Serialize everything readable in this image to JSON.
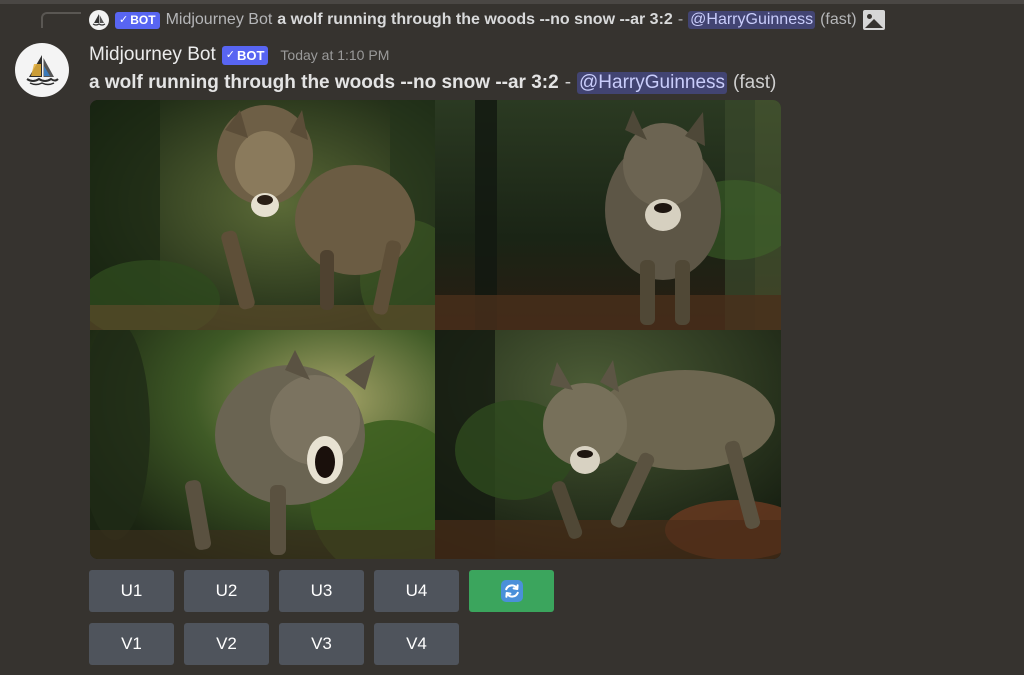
{
  "reply": {
    "bot_label": "BOT",
    "author": "Midjourney Bot",
    "prompt": "a wolf running through the woods --no snow --ar 3:2",
    "separator": "-",
    "mention": "@HarryGuinness",
    "speed": "(fast)"
  },
  "message": {
    "author": "Midjourney Bot",
    "bot_label": "BOT",
    "timestamp": "Today at 1:10 PM",
    "prompt": "a wolf running through the woods --no snow --ar 3:2",
    "separator": "-",
    "mention": "@HarryGuinness",
    "speed": "(fast)"
  },
  "image_grid": {
    "tiles": [
      "wolf-image-1",
      "wolf-image-2",
      "wolf-image-3",
      "wolf-image-4"
    ]
  },
  "buttons": {
    "upscale": [
      "U1",
      "U2",
      "U3",
      "U4"
    ],
    "variation": [
      "V1",
      "V2",
      "V3",
      "V4"
    ],
    "reroll_icon": "refresh-icon"
  },
  "colors": {
    "background": "#36332f",
    "bot_tag": "#5865f2",
    "button": "#4f545c",
    "reroll_button": "#3ba55d"
  }
}
